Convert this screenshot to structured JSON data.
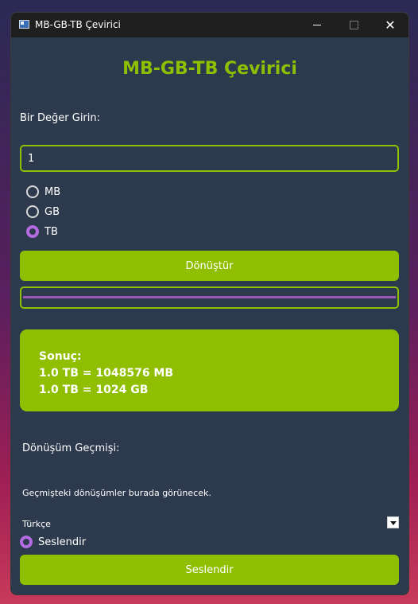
{
  "window": {
    "title": "MB-GB-TB Çevirici"
  },
  "heading": "MB-GB-TB Çevirici",
  "input": {
    "label": "Bir Değer Girin:",
    "value": "1"
  },
  "units": [
    {
      "label": "MB",
      "checked": false
    },
    {
      "label": "GB",
      "checked": false
    },
    {
      "label": "TB",
      "checked": true
    }
  ],
  "convert_button": "Dönüştür",
  "progress": {
    "value_percent": 100
  },
  "result": {
    "title": "Sonuç:",
    "line1": "1.0 TB = 1048576 MB",
    "line2": "1.0 TB = 1024 GB"
  },
  "history": {
    "title": "Dönüşüm Geçmişi:",
    "empty_text": "Geçmişteki dönüşümler burada görünecek."
  },
  "language": {
    "selected": "Türkçe"
  },
  "speak": {
    "radio_label": "Seslendir",
    "button_label": "Seslendir"
  },
  "colors": {
    "accent": "#8fbf00",
    "background": "#2d3a4d",
    "radio_checked": "#b36be0",
    "progress_fill": "#9b59b6"
  }
}
